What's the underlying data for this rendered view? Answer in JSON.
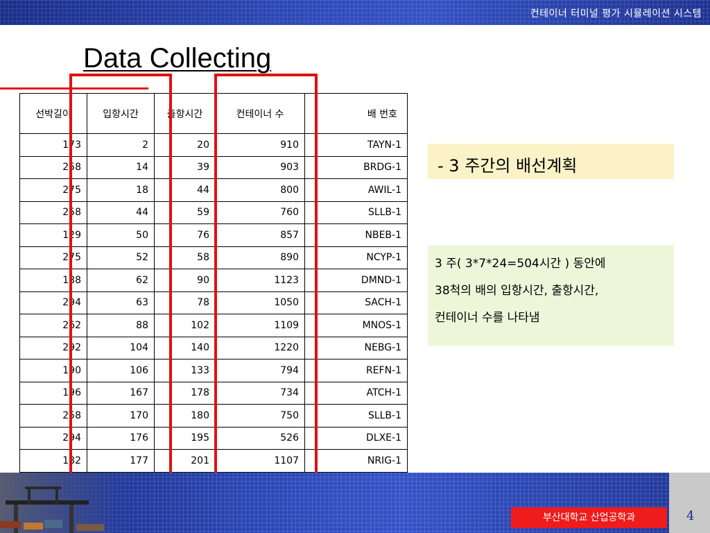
{
  "header": {
    "system_title": "컨테이너 터미널 평가 시뮬레이션 시스템"
  },
  "slide": {
    "title": "Data Collecting"
  },
  "table": {
    "columns": [
      "선박길이",
      "입항시간",
      "출항시간",
      "컨테이너 수",
      "배 번호"
    ],
    "rows": [
      [
        "173",
        "2",
        "20",
        "910",
        "TAYN-1"
      ],
      [
        "258",
        "14",
        "39",
        "903",
        "BRDG-1"
      ],
      [
        "275",
        "18",
        "44",
        "800",
        "AWIL-1"
      ],
      [
        "258",
        "44",
        "59",
        "760",
        "SLLB-1"
      ],
      [
        "129",
        "50",
        "76",
        "857",
        "NBEB-1"
      ],
      [
        "275",
        "52",
        "58",
        "890",
        "NCYP-1"
      ],
      [
        "188",
        "62",
        "90",
        "1123",
        "DMND-1"
      ],
      [
        "294",
        "63",
        "78",
        "1050",
        "SACH-1"
      ],
      [
        "262",
        "88",
        "102",
        "1109",
        "MNOS-1"
      ],
      [
        "292",
        "104",
        "140",
        "1220",
        "NEBG-1"
      ],
      [
        "190",
        "106",
        "133",
        "794",
        "REFN-1"
      ],
      [
        "196",
        "167",
        "178",
        "734",
        "ATCH-1"
      ],
      [
        "258",
        "170",
        "180",
        "750",
        "SLLB-1"
      ],
      [
        "294",
        "176",
        "195",
        "526",
        "DLXE-1"
      ],
      [
        "182",
        "177",
        "201",
        "1107",
        "NRIG-1"
      ]
    ]
  },
  "plan_box": {
    "text": "- 3 주간의 배선계획"
  },
  "desc_box": {
    "lines": [
      "3 주( 3*7*24=504시간 ) 동안에",
      "38척의 배의 입항시간, 출항시간,",
      "컨테이너 수를 나타냄"
    ]
  },
  "footer": {
    "university": "부산대학교   산업공학과",
    "page_number": "4"
  },
  "colors": {
    "banner": "#2d48b6",
    "highlight": "#e01010",
    "plan_bg": "#fbf2c8",
    "desc_bg": "#eef6da",
    "label_red": "#ee1c1c"
  },
  "icons": {
    "footer_image": "container-crane-photo"
  }
}
